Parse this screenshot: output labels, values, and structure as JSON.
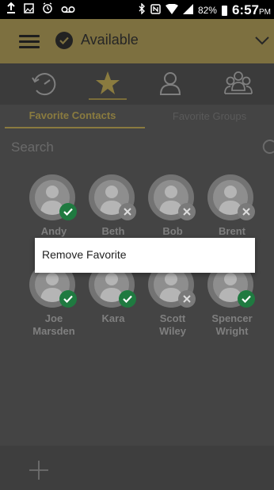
{
  "status_bar": {
    "battery_percent": "82%",
    "time": "6:57",
    "ampm": "PM",
    "icons": [
      "upload-icon",
      "image-icon",
      "alarm-icon",
      "voicemail-icon",
      "bluetooth-icon",
      "nfc-icon",
      "wifi-icon",
      "signal-icon",
      "battery-icon"
    ]
  },
  "app_bar": {
    "status_label": "Available",
    "icons": [
      "menu-icon",
      "check-icon",
      "chevron-down-icon"
    ]
  },
  "tabs": [
    {
      "name": "recent",
      "icon": "history-icon",
      "active": false
    },
    {
      "name": "favorites",
      "icon": "star-icon",
      "active": true
    },
    {
      "name": "contacts",
      "icon": "person-icon",
      "active": false
    },
    {
      "name": "groups",
      "icon": "group-icon",
      "active": false
    }
  ],
  "sub_tabs": {
    "favorite_contacts": "Favorite Contacts",
    "favorite_groups": "Favorite Groups"
  },
  "search": {
    "placeholder": "Search"
  },
  "contacts": [
    {
      "name": "Andy",
      "status": "online"
    },
    {
      "name": "Beth",
      "status": "offline"
    },
    {
      "name": "Bob",
      "status": "offline"
    },
    {
      "name": "Brent",
      "status": "offline"
    },
    {
      "name": "Joe Marsden",
      "line1": "Joe",
      "line2": "Marsden",
      "status": "online"
    },
    {
      "name": "Kara",
      "status": "online"
    },
    {
      "name": "Scott Wiley",
      "line1": "Scott",
      "line2": "Wiley",
      "status": "offline"
    },
    {
      "name": "Spencer Wright",
      "line1": "Spencer",
      "line2": "Wright",
      "status": "online"
    }
  ],
  "context_menu": {
    "remove_favorite": "Remove Favorite"
  },
  "bottom_bar": {
    "icon": "add-icon"
  },
  "colors": {
    "accent": "#8a7b3f",
    "appbar": "#7d7040",
    "online": "#1f7a40",
    "offline": "#7a7a7a"
  }
}
